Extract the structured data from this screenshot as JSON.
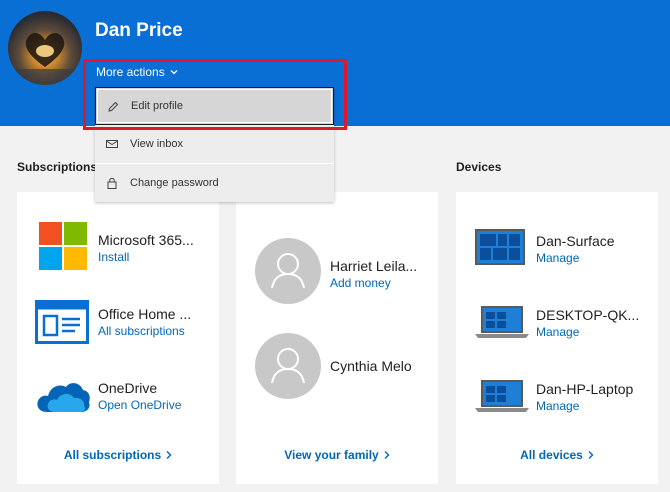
{
  "profile": {
    "name": "Dan Price",
    "more_actions_label": "More actions"
  },
  "menu": {
    "items": [
      {
        "label": "Edit profile",
        "icon": "pencil-icon"
      },
      {
        "label": "View inbox",
        "icon": "envelope-icon"
      },
      {
        "label": "Change password",
        "icon": "lock-icon"
      }
    ]
  },
  "subscriptions": {
    "title": "Subscriptions",
    "items": [
      {
        "name": "Microsoft 365...",
        "action": "Install",
        "icon": "microsoft-logo-icon"
      },
      {
        "name": "Office Home ...",
        "action": "All subscriptions",
        "icon": "office-home-icon"
      },
      {
        "name": "OneDrive",
        "action": "Open OneDrive",
        "icon": "onedrive-cloud-icon"
      }
    ],
    "footer": "All subscriptions"
  },
  "family": {
    "members": [
      {
        "name": "Harriet Leila...",
        "action": "Add money"
      },
      {
        "name": "Cynthia Melo",
        "action": ""
      }
    ],
    "footer": "View your family"
  },
  "devices": {
    "title": "Devices",
    "items": [
      {
        "name": "Dan-Surface",
        "action": "Manage",
        "icon": "tablet-icon"
      },
      {
        "name": "DESKTOP-QK...",
        "action": "Manage",
        "icon": "laptop-icon"
      },
      {
        "name": "Dan-HP-Laptop",
        "action": "Manage",
        "icon": "laptop-icon"
      }
    ],
    "footer": "All devices"
  },
  "colors": {
    "header_blue": "#0a6fd4",
    "link_blue": "#0067b8",
    "highlight_red": "#e0162b"
  }
}
